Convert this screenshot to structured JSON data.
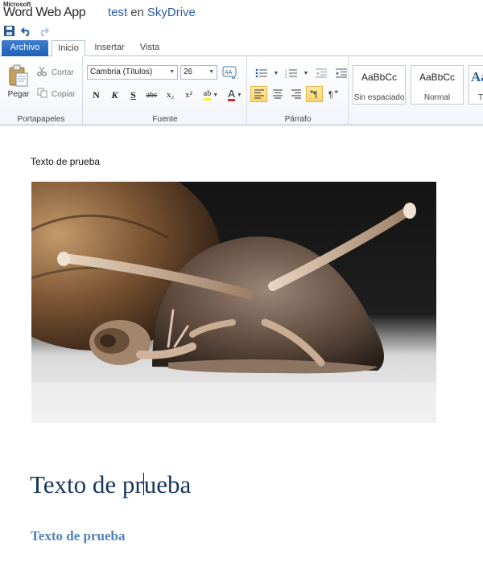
{
  "titlebar": {
    "brand_small": "Microsoft",
    "app_name": "Word Web App",
    "doc_name": "test",
    "separator": "en",
    "location": "SkyDrive"
  },
  "qat": {
    "save_icon": "save-icon",
    "undo_icon": "undo-icon",
    "redo_icon": "redo-icon"
  },
  "tabs": [
    {
      "label": "Archivo"
    },
    {
      "label": "Inicio"
    },
    {
      "label": "Insertar"
    },
    {
      "label": "Vista"
    }
  ],
  "ribbon": {
    "clipboard": {
      "label": "Portapapeles",
      "paste": "Pegar",
      "cut": "Cortar",
      "copy": "Copiar"
    },
    "font": {
      "label": "Fuente",
      "font_name": "Cambria (Títulos)",
      "font_size": "26",
      "bold": "N",
      "italic": "K",
      "underline": "S",
      "strike": "abc",
      "subscript": "x₂",
      "superscript": "x²",
      "highlight": "ab",
      "font_color": "A"
    },
    "paragraph": {
      "label": "Párrafo"
    },
    "styles": {
      "items": [
        {
          "sample": "AaBbCc",
          "name": "Sin espaciado"
        },
        {
          "sample": "AaBbCc",
          "name": "Normal"
        },
        {
          "sample": "Aa",
          "name": "T"
        }
      ]
    }
  },
  "document": {
    "paragraph1": "Texto de prueba",
    "heading1_before_caret": "Texto de pr",
    "heading1_after_caret": "ueba",
    "heading2": "Texto de prueba"
  },
  "colors": {
    "accent": "#2a5ca8",
    "file_tab": "#2b6ac0",
    "heading1": "#17365d",
    "heading2": "#4f81bd"
  }
}
